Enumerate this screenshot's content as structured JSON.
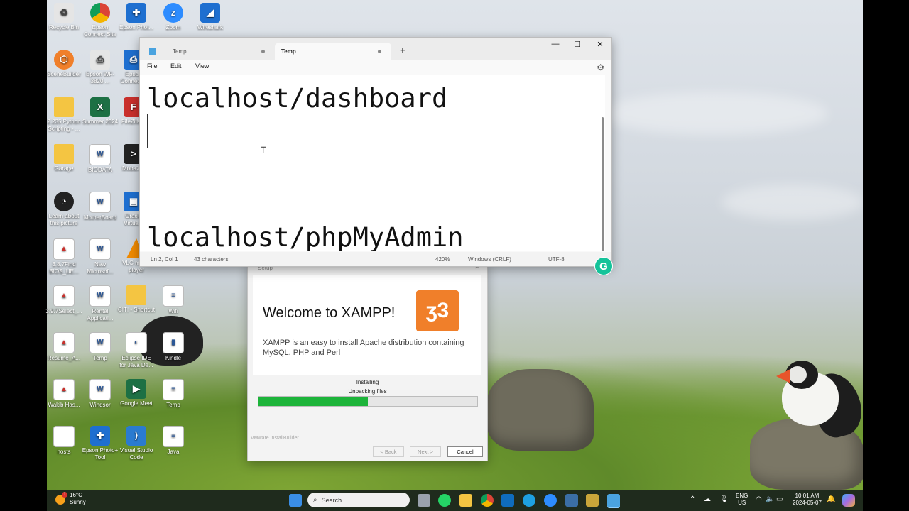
{
  "desktop": {
    "icons": [
      {
        "label": "Recycle Bin",
        "glyph": "recycle-bin-icon"
      },
      {
        "label": "Epson Connect Site",
        "glyph": "chrome-icon"
      },
      {
        "label": "Epson Phot...",
        "glyph": "epson-photo-icon"
      },
      {
        "label": "Zoom",
        "glyph": "zoom-icon"
      },
      {
        "label": "Wireshark",
        "glyph": "wireshark-icon"
      },
      {
        "label": "SceneBuilder",
        "glyph": "scenebuilder-icon"
      },
      {
        "label": "Epson WF-3820 ...",
        "glyph": "epson-printer-icon"
      },
      {
        "label": "Epson Connect...",
        "glyph": "epson-connect-icon"
      },
      {
        "label": "2.235 Python Scripting - ...",
        "glyph": "folder-icon"
      },
      {
        "label": "Summer 2024",
        "glyph": "excel-icon"
      },
      {
        "label": "FileZilla...",
        "glyph": "filezilla-icon"
      },
      {
        "label": "Garage",
        "glyph": "folder-icon"
      },
      {
        "label": "BIODATA",
        "glyph": "word-icon"
      },
      {
        "label": "MobaX...",
        "glyph": "mobaxterm-icon"
      },
      {
        "label": "Learn about this picture",
        "glyph": "learn-picture-icon"
      },
      {
        "label": "MotherBoard",
        "glyph": "word-icon"
      },
      {
        "label": "Oracle Virtua...",
        "glyph": "virtualbox-icon"
      },
      {
        "label": "3.8.7Find BIOS_UE...",
        "glyph": "pdf-icon"
      },
      {
        "label": "New Microsof...",
        "glyph": "word-icon"
      },
      {
        "label": "VLC media player",
        "glyph": "vlc-icon"
      },
      {
        "label": "3.9.7Select_...",
        "glyph": "pdf-icon"
      },
      {
        "label": "Rental Applicati...",
        "glyph": "word-icon"
      },
      {
        "label": "CITI - Shortcut",
        "glyph": "folder-icon"
      },
      {
        "label": "Wifi",
        "glyph": "text-file-icon"
      },
      {
        "label": "Resume_A...",
        "glyph": "pdf-icon"
      },
      {
        "label": "Temp",
        "glyph": "word-icon"
      },
      {
        "label": "Eclipse IDE for Java De...",
        "glyph": "eclipse-icon"
      },
      {
        "label": "Kindle",
        "glyph": "kindle-icon"
      },
      {
        "label": "Wakib Has...",
        "glyph": "pdf-icon"
      },
      {
        "label": "Windsor",
        "glyph": "word-icon"
      },
      {
        "label": "Google Meet",
        "glyph": "google-meet-icon"
      },
      {
        "label": "Temp",
        "glyph": "text-file-icon"
      },
      {
        "label": "hosts",
        "glyph": "file-icon"
      },
      {
        "label": "Epson Photo+ Tool",
        "glyph": "epson-photo-icon"
      },
      {
        "label": "Visual Studio Code",
        "glyph": "vscode-icon"
      },
      {
        "label": "Java",
        "glyph": "text-file-icon"
      }
    ]
  },
  "notepad": {
    "tabs": [
      {
        "label": "Temp"
      },
      {
        "label": "Temp"
      }
    ],
    "new_tab": "+",
    "controls": {
      "minimize": "—",
      "maximize": "☐",
      "close": "✕"
    },
    "menu": {
      "file": "File",
      "edit": "Edit",
      "view": "View"
    },
    "settings_icon": "⚙",
    "lines": {
      "line1": "localhost/dashboard",
      "line2": "localhost/phpMyAdmin"
    },
    "status": {
      "position": "Ln 2, Col 1",
      "chars": "43 characters",
      "zoom": "420%",
      "line_ending": "Windows (CRLF)",
      "encoding": "UTF-8"
    }
  },
  "grammarly": {
    "label": "G"
  },
  "xampp_setup": {
    "title": "Setup",
    "close": "✕",
    "welcome": "Welcome to XAMPP!",
    "logo_glyph": "ʒ3",
    "description": "XAMPP is an easy to install Apache distribution containing MySQL, PHP and Perl",
    "status1": "Installing",
    "status2": "Unpacking files",
    "progress": 0.5,
    "vendor": "VMware InstallBuilder",
    "buttons": {
      "back": "< Back",
      "next": "Next >",
      "cancel": "Cancel"
    }
  },
  "taskbar": {
    "weather_temp": "16°C",
    "weather_cond": "Sunny",
    "weather_badge": "1",
    "search_placeholder": "Search",
    "lang_top": "ENG",
    "lang_bottom": "US",
    "time": "10:01 AM",
    "date": "2024-05-07"
  },
  "colors": {
    "xampp_orange": "#f07f2a",
    "progress_green": "#1db43a",
    "taskbar_bg": "#1f2b1d"
  }
}
